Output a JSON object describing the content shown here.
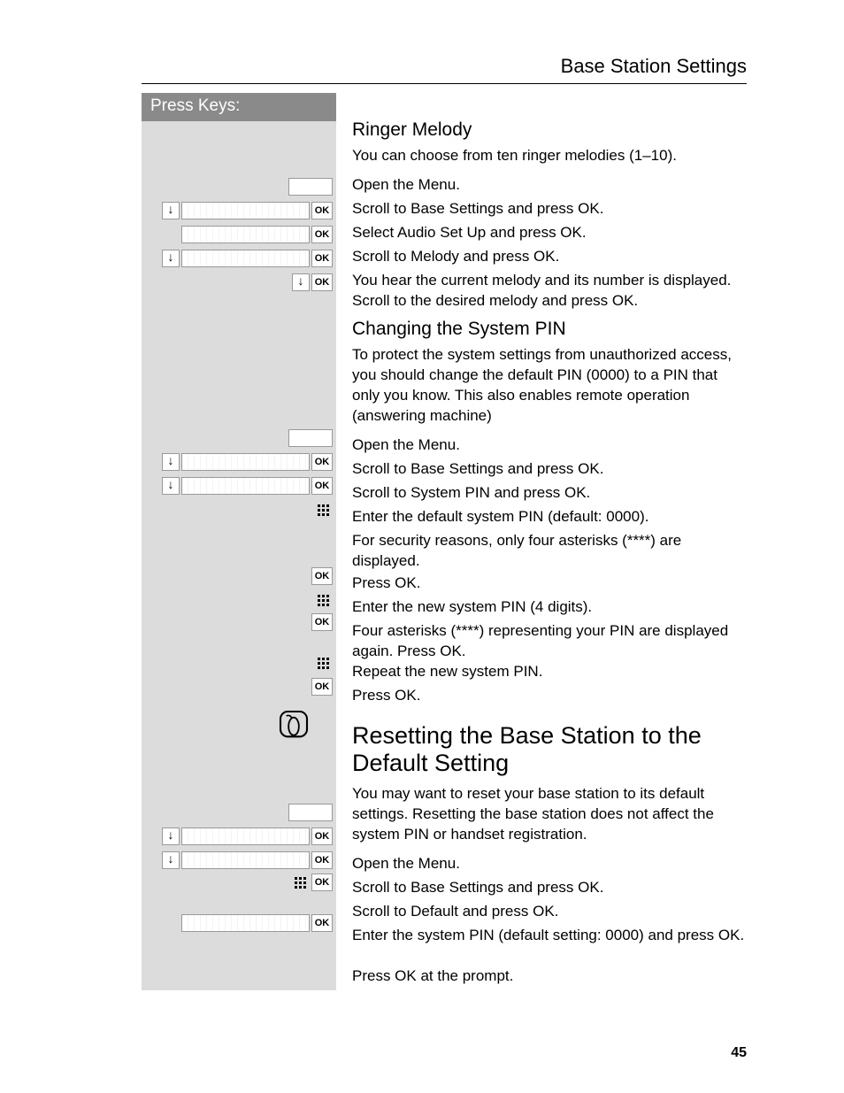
{
  "header": {
    "title": "Base Station Settings"
  },
  "pageNumber": "45",
  "leftHeader": "Press Keys:",
  "ok": "OK",
  "sections": {
    "ringer": {
      "heading": "Ringer Melody",
      "intro": "You can choose from ten ringer melodies (1–10).",
      "steps": [
        "Open the Menu.",
        "Scroll to Base Settings and press OK.",
        "Select Audio Set Up and press OK.",
        "Scroll to Melody and press OK.",
        "You hear the current melody and its number is displayed. Scroll to the desired melody and press OK."
      ]
    },
    "pin": {
      "heading": "Changing the System PIN",
      "intro": "To protect the system settings from unauthorized access, you should change the default PIN (0000) to a PIN that only you know. This also enables remote operation (answering machine)",
      "steps": [
        "Open the Menu.",
        "Scroll to Base Settings and press OK.",
        "Scroll to System PIN and press OK.",
        "Enter the default system PIN (default: 0000).",
        "For security reasons, only four asterisks (****) are displayed.",
        "Press OK.",
        "Enter the new system PIN (4 digits).",
        "Four asterisks (****) representing your PIN are displayed again. Press OK.",
        "Repeat the new system PIN.",
        "Press OK."
      ]
    },
    "reset": {
      "heading": "Resetting the Base Station to the Default Setting",
      "intro": "You may want to reset your base station to its default settings. Resetting the base station does not affect the system PIN or handset registration.",
      "steps": [
        "Open the Menu.",
        "Scroll to Base Settings and press OK.",
        "Scroll to Default and press OK.",
        "Enter the system PIN (default setting: 0000) and press OK.",
        "Press OK at the prompt."
      ]
    }
  }
}
